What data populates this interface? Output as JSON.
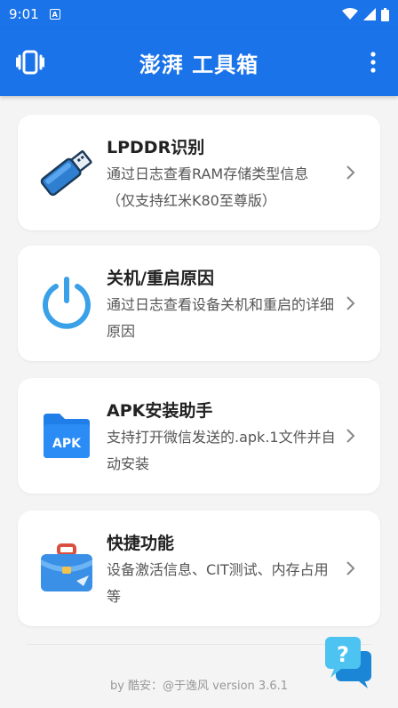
{
  "status_bar": {
    "time": "9:01",
    "notif_letter": "A"
  },
  "app_bar": {
    "title": "澎湃 工具箱"
  },
  "cards": [
    {
      "title": "LPDDR识别",
      "description": "通过日志查看RAM存储类型信息（仅支持红米K80至尊版）"
    },
    {
      "title": "关机/重启原因",
      "description": "通过日志查看设备关机和重启的详细原因"
    },
    {
      "title": "APK安装助手",
      "description": "支持打开微信发送的.apk.1文件并自动安装",
      "icon_text": "APK"
    },
    {
      "title": "快捷功能",
      "description": "设备激活信息、CIT测试、内存占用等"
    }
  ],
  "footer": {
    "text": "by 酷安：@于逸风 version 3.6.1"
  },
  "help": {
    "label": "?"
  },
  "colors": {
    "primary": "#1a73e8",
    "background": "#f4f4f4",
    "card": "#ffffff"
  }
}
